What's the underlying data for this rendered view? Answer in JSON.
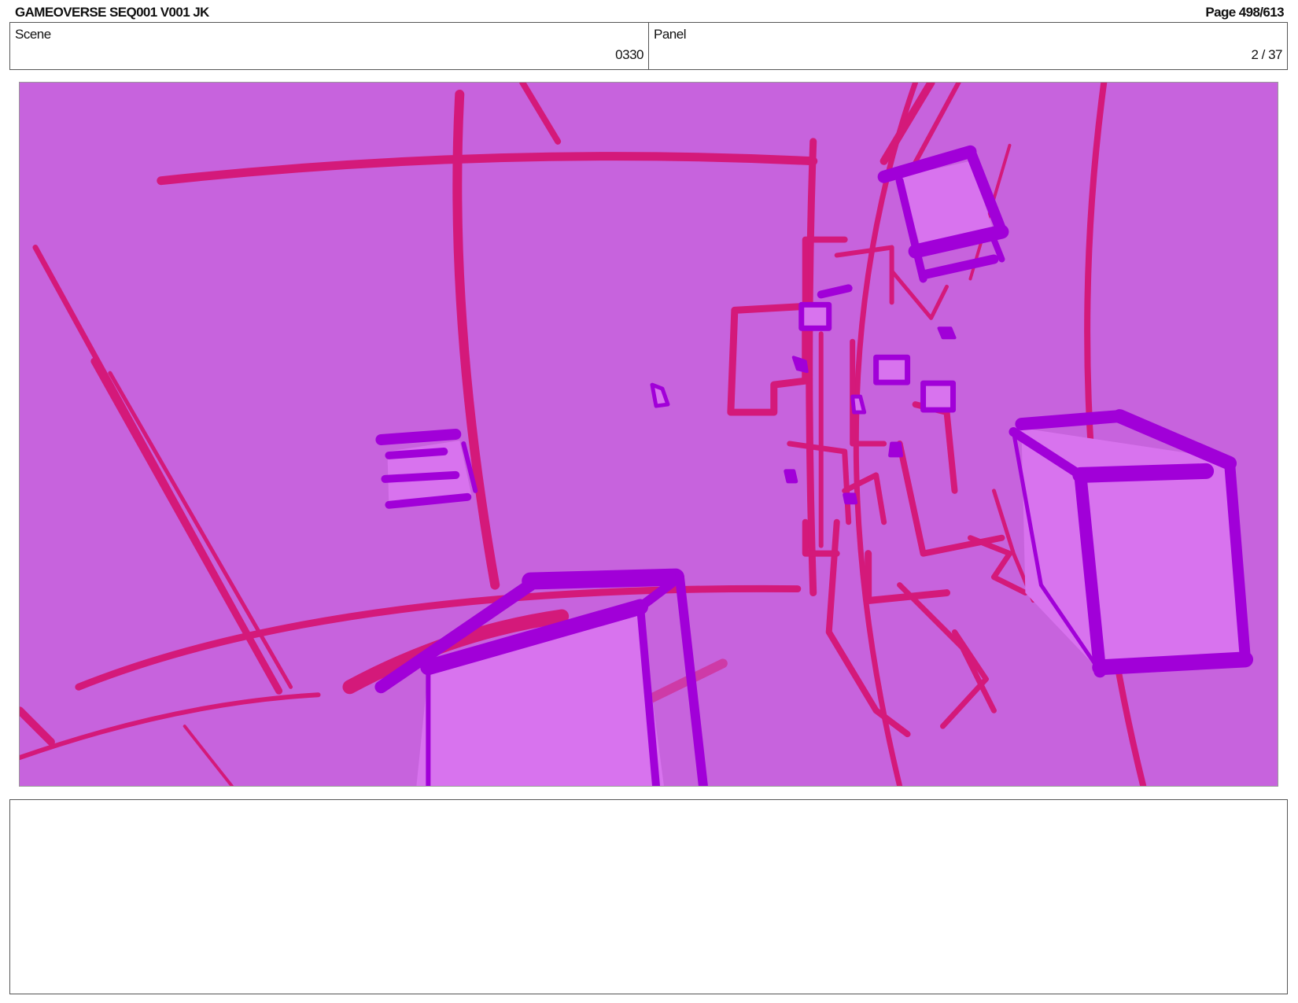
{
  "header": {
    "title": "GAMEOVERSE SEQ001 V001 JK",
    "page": "Page 498/613"
  },
  "info": {
    "scene_label": "Scene",
    "scene_value": "0330",
    "panel_label": "Panel",
    "panel_value": "2 / 37"
  },
  "colors": {
    "background": "#c763dd",
    "line_pink": "#d4197a",
    "cube_purple": "#a100d8",
    "cube_face": "#d873ee"
  },
  "notes": {
    "text": ""
  }
}
